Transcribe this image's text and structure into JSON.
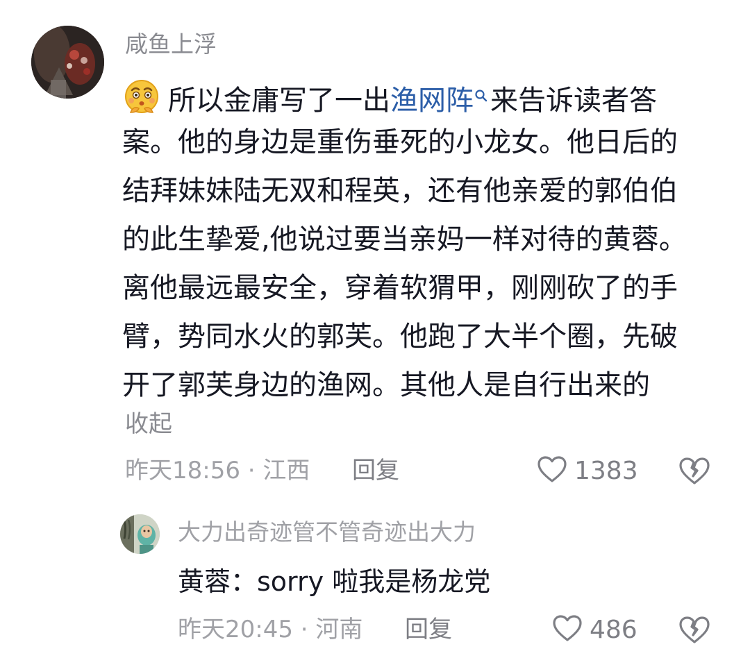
{
  "comment": {
    "username": "咸鱼上浮",
    "avatar_icon": "avatar-image",
    "emoji_icon": "thinking-face-emoji",
    "text_before_keyword": "所以金庸写了一出",
    "keyword": "渔网阵",
    "search_icon": "search-icon",
    "text_line1_after_keyword": "来告诉读者答",
    "lines": [
      "案。他的身边是重伤垂死的小龙女。他日后的",
      "结拜妹妹陆无双和程英，还有他亲爱的郭伯伯",
      "的此生挚爱,他说过要当亲妈一样对待的黄蓉。",
      "离他最远最安全，穿着软猬甲，刚刚砍了的手",
      "臂，势同水火的郭芙。他跑了大半个圈，先破",
      "开了郭芙身边的渔网。其他人是自行出来的"
    ],
    "collapse_label": "收起",
    "meta": "昨天18:56 · 江西",
    "reply_label": "回复",
    "like_count": "1383",
    "like_icon": "heart-outline-icon",
    "dislike_icon": "broken-heart-icon"
  },
  "reply": {
    "username": "大力出奇迹管不管奇迹出大力",
    "avatar_icon": "avatar-image",
    "text": "黄蓉：sorry 啦我是杨龙党",
    "meta": "昨天20:45 · 河南",
    "reply_label": "回复",
    "like_count": "486",
    "like_icon": "heart-outline-icon",
    "dislike_icon": "broken-heart-icon"
  },
  "colors": {
    "text_primary": "#161823",
    "text_secondary": "#8a8b91",
    "text_meta": "#a0a1a6",
    "keyword_link": "#2c5ea8"
  }
}
